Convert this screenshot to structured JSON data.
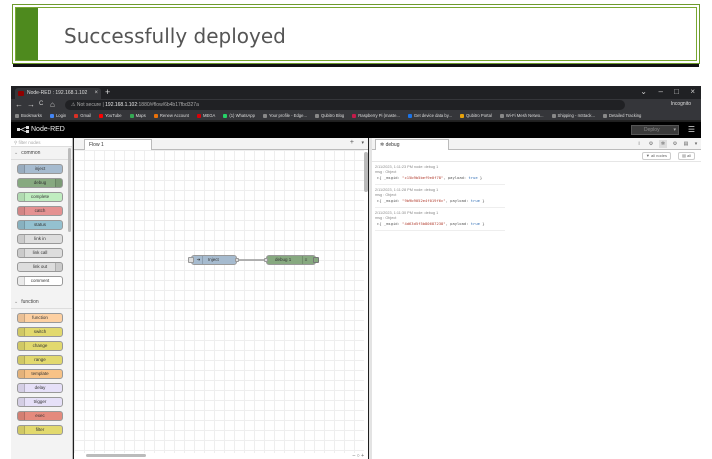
{
  "banner": {
    "message": "Successfully deployed",
    "accent": "#4e8a1e"
  },
  "browser": {
    "tab_title": "Node-RED : 192.168.1.102",
    "new_tab": "+",
    "win_controls": [
      "⌄",
      "–",
      "□",
      "×"
    ],
    "nav": {
      "back": "←",
      "forward": "→",
      "reload": "C",
      "home": "⌂"
    },
    "url_prefix": "⚠ Not secure |",
    "url_host": "192.168.1.102",
    "url_rest": ":1880/#flow/6b4b17fbd327a",
    "incognito": "Incognito",
    "bookmarks": [
      {
        "label": "Bookmarks",
        "color": "#888"
      },
      {
        "label": "Login",
        "color": "#4285f4"
      },
      {
        "label": "Gmail",
        "color": "#d93025"
      },
      {
        "label": "YouTube",
        "color": "#ff0000"
      },
      {
        "label": "Maps",
        "color": "#34a853"
      },
      {
        "label": "Renew Account",
        "color": "#e8710a"
      },
      {
        "label": "MEGA",
        "color": "#d90007"
      },
      {
        "label": "(1) WhatsApp",
        "color": "#25d366"
      },
      {
        "label": "Your profile - Edge...",
        "color": "#888"
      },
      {
        "label": "Qubitro Blog",
        "color": "#888"
      },
      {
        "label": "Raspberry Pi (maste...",
        "color": "#c51a4a"
      },
      {
        "label": "Get device data by...",
        "color": "#1a73e8"
      },
      {
        "label": "Qubitro Portal",
        "color": "#e8a20a"
      },
      {
        "label": "Wi-Fi Mesh Netwo...",
        "color": "#888"
      },
      {
        "label": "Shipping - mStack...",
        "color": "#888"
      },
      {
        "label": "Detailed Tracking",
        "color": "#888"
      }
    ]
  },
  "nodered": {
    "logo": "Node-RED",
    "deploy_label": "Deploy",
    "menu_icon": "☰",
    "palette": {
      "filter_placeholder": "filter nodes",
      "categories": [
        {
          "name": "common",
          "nodes": [
            {
              "label": "inject",
              "color": "#a6bbcf",
              "icon_side": "left"
            },
            {
              "label": "debug",
              "color": "#87a980",
              "icon_side": "right"
            },
            {
              "label": "complete",
              "color": "#c0edc0",
              "icon_side": "left"
            },
            {
              "label": "catch",
              "color": "#e49191",
              "icon_side": "left"
            },
            {
              "label": "status",
              "color": "#94c1d0",
              "icon_side": "left"
            },
            {
              "label": "link in",
              "color": "#dddddd",
              "icon_side": "left"
            },
            {
              "label": "link call",
              "color": "#dddddd",
              "icon_side": "left"
            },
            {
              "label": "link out",
              "color": "#dddddd",
              "icon_side": "right"
            },
            {
              "label": "comment",
              "color": "#ffffff",
              "icon_side": "left"
            }
          ]
        },
        {
          "name": "function",
          "nodes": [
            {
              "label": "function",
              "color": "#fdd0a2",
              "icon_side": "left"
            },
            {
              "label": "switch",
              "color": "#e2d96e",
              "icon_side": "left"
            },
            {
              "label": "change",
              "color": "#e2d96e",
              "icon_side": "left"
            },
            {
              "label": "range",
              "color": "#e2d96e",
              "icon_side": "left"
            },
            {
              "label": "template",
              "color": "#f7c286",
              "icon_side": "left"
            },
            {
              "label": "delay",
              "color": "#e6e0f8",
              "icon_side": "left"
            },
            {
              "label": "trigger",
              "color": "#e6e0f8",
              "icon_side": "left"
            },
            {
              "label": "exec",
              "color": "#e48a7d",
              "icon_side": "left"
            },
            {
              "label": "filter",
              "color": "#e2d96e",
              "icon_side": "left"
            }
          ]
        }
      ]
    },
    "workspace": {
      "flow_tab": "Flow 1",
      "add_icon": "+",
      "more_icon": "▾",
      "inject_node": "Inject",
      "debug_node": "debug 1",
      "footer": "– ○ +"
    },
    "sidebar": {
      "tab": "debug",
      "filter_label": "▼ all nodes",
      "clear_label": "▤ all",
      "messages": [
        {
          "meta": "2/11/2023, 1:11:23 PM   node: debug 1",
          "type": "msg : Object",
          "body_pre": "▸{ _msgid: ",
          "msgid": "\"c15b9b5bef9e0f78\"",
          "body_mid": ", payload: ",
          "payload": "true",
          "body_post": " }"
        },
        {
          "meta": "2/11/2023, 1:11:28 PM   node: debug 1",
          "type": "msg : Object",
          "body_pre": "▸{ _msgid: ",
          "msgid": "\"9b9b9052e4f019f6c\"",
          "body_mid": ", payload: ",
          "payload": "true",
          "body_post": " }"
        },
        {
          "meta": "2/11/2023, 1:11:30 PM   node: debug 1",
          "type": "msg : Object",
          "body_pre": "▸{ _msgid: ",
          "msgid": "\"4d63d5f5b80687238\"",
          "body_mid": ", payload: ",
          "payload": "true",
          "body_post": " }"
        }
      ]
    }
  }
}
